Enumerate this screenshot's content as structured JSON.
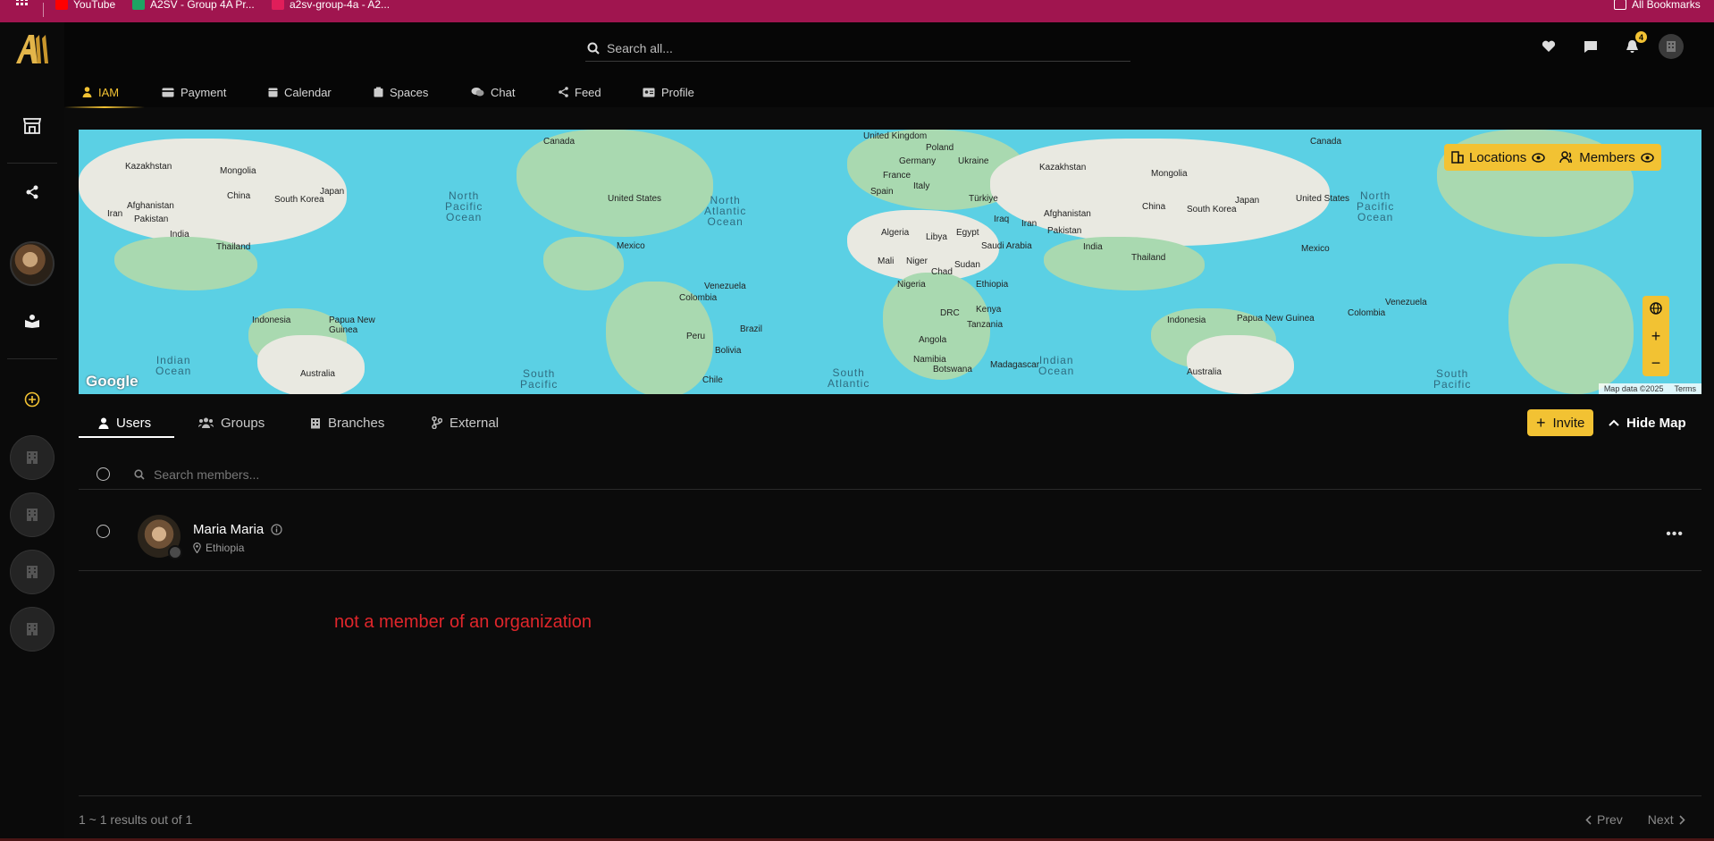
{
  "bookmarks": {
    "items": [
      {
        "label": "YouTube",
        "color": "#ff0000"
      },
      {
        "label": "A2SV - Group 4A Pr...",
        "color": "#1fa463"
      },
      {
        "label": "a2sv-group-4a - A2...",
        "color": "#e01e5a"
      }
    ],
    "all_label": "All Bookmarks"
  },
  "header": {
    "search_placeholder": "Search all...",
    "notification_count": "4"
  },
  "tabs": [
    {
      "label": "IAM",
      "icon": "user-icon"
    },
    {
      "label": "Payment",
      "icon": "card-icon"
    },
    {
      "label": "Calendar",
      "icon": "calendar-icon"
    },
    {
      "label": "Spaces",
      "icon": "spaces-icon"
    },
    {
      "label": "Chat",
      "icon": "chat-icon"
    },
    {
      "label": "Feed",
      "icon": "share-icon"
    },
    {
      "label": "Profile",
      "icon": "id-card-icon"
    }
  ],
  "map": {
    "toggles": [
      "Locations",
      "Members"
    ],
    "attribution": "Map data ©2025",
    "terms": "Terms",
    "google_label": "Google",
    "countries": [
      "Canada",
      "United States",
      "Mexico",
      "Venezuela",
      "Colombia",
      "Peru",
      "Brazil",
      "Bolivia",
      "Chile",
      "United Kingdom",
      "Poland",
      "Germany",
      "Ukraine",
      "France",
      "Spain",
      "Italy",
      "Türkiye",
      "Algeria",
      "Libya",
      "Egypt",
      "Mali",
      "Niger",
      "Chad",
      "Sudan",
      "Nigeria",
      "Ethiopia",
      "DRC",
      "Kenya",
      "Tanzania",
      "Angola",
      "Namibia",
      "Botswana",
      "Madagascar",
      "Saudi Arabia",
      "Iraq",
      "Iran",
      "Afghanistan",
      "Pakistan",
      "India",
      "Kazakhstan",
      "Mongolia",
      "China",
      "South Korea",
      "Japan",
      "Thailand",
      "Indonesia",
      "Papua New Guinea",
      "Australia"
    ],
    "oceans": [
      "North Pacific Ocean",
      "North Atlantic Ocean",
      "South Pacific",
      "South Atlantic",
      "Indian Ocean"
    ]
  },
  "members": {
    "tabs": [
      "Users",
      "Groups",
      "Branches",
      "External"
    ],
    "invite_label": "Invite",
    "hide_map_label": "Hide Map",
    "search_placeholder": "Search members...",
    "rows": [
      {
        "name": "Maria Maria",
        "location": "Ethiopia"
      }
    ],
    "note": "not a member of an organization",
    "results": "1 ~ 1 results out of 1",
    "prev": "Prev",
    "next": "Next"
  },
  "colors": {
    "accent": "#f2c233",
    "bookmark_bar": "#a0154f",
    "note": "#e0262b"
  }
}
